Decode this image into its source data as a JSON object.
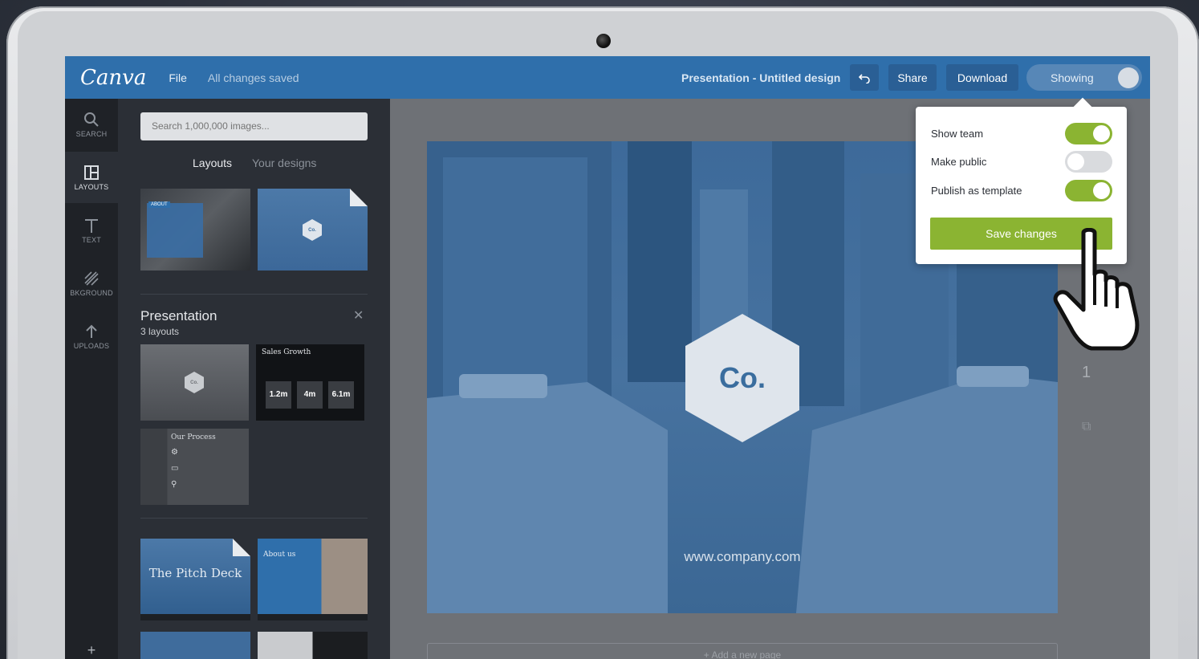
{
  "app": {
    "logo": "Canva",
    "menu_file": "File",
    "save_status": "All changes saved",
    "document_title": "Presentation - Untitled design",
    "share_label": "Share",
    "download_label": "Download",
    "showing_label": "Showing"
  },
  "rail": {
    "items": [
      {
        "label": "SEARCH",
        "icon": "search-icon"
      },
      {
        "label": "LAYOUTS",
        "icon": "layout-icon"
      },
      {
        "label": "TEXT",
        "icon": "text-icon"
      },
      {
        "label": "BKGROUND",
        "icon": "background-icon"
      },
      {
        "label": "UPLOADS",
        "icon": "upload-icon"
      }
    ],
    "add_label": "+"
  },
  "panel": {
    "search_placeholder": "Search 1,000,000 images...",
    "tab_layouts": "Layouts",
    "tab_designs": "Your designs",
    "section_title": "Presentation",
    "section_subtitle": "3 layouts",
    "thumbs": {
      "about_tag": "ABOUT",
      "co_logo": "Co.",
      "sales_growth": "Sales Growth",
      "stat_1": "1.2m",
      "stat_2": "4m",
      "stat_3": "6.1m",
      "our_process": "Our Process",
      "pitch_deck": "The Pitch Deck",
      "about_us": "About us"
    }
  },
  "canvas": {
    "logo_text": "Co.",
    "url_text": "www.company.com",
    "add_page": "+ Add a new page",
    "page_number": "1"
  },
  "popover": {
    "show_team": "Show team",
    "show_team_on": true,
    "make_public": "Make public",
    "make_public_on": false,
    "publish_template": "Publish as template",
    "publish_template_on": true,
    "save_label": "Save changes"
  },
  "colors": {
    "topbar": "#2f6fab",
    "accent_green": "#8bb432",
    "rail": "#1f2227",
    "panel": "#2b2f36"
  }
}
